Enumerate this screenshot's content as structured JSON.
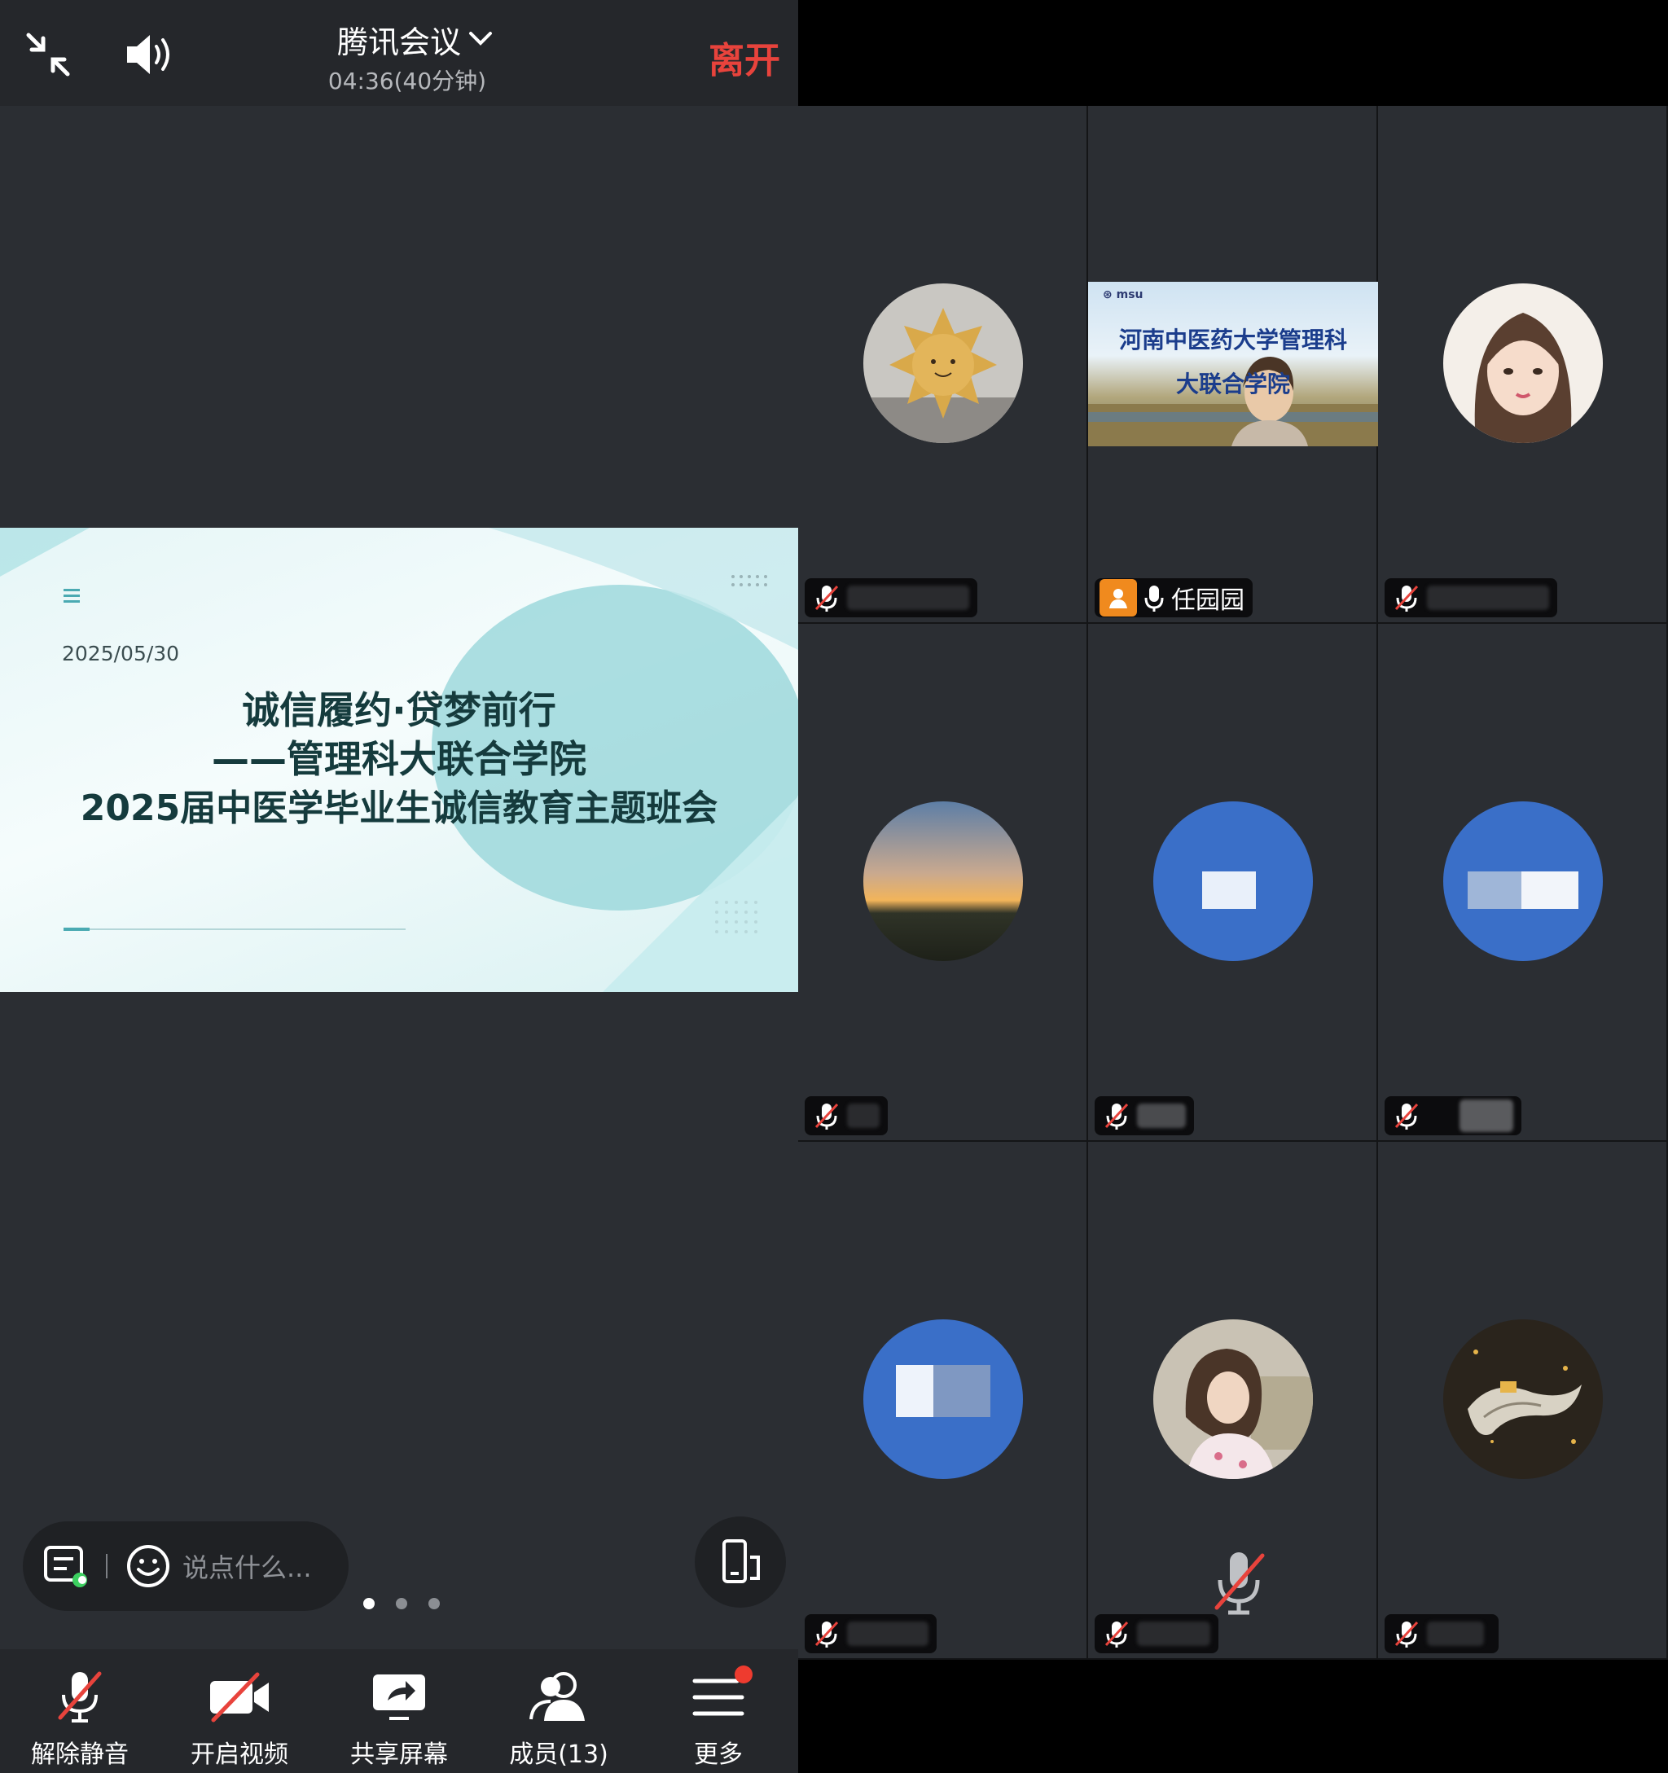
{
  "header": {
    "title": "腾讯会议",
    "elapsed": "04:36(40分钟)",
    "leave_label": "离开"
  },
  "slide": {
    "date": "2025/05/30",
    "line1": "诚信履约·贷梦前行",
    "line2": "——管理科大联合学院",
    "line3": "2025届中医学毕业生诚信教育主题班会"
  },
  "chat": {
    "placeholder": "说点什么..."
  },
  "pagination": {
    "count": 3,
    "active": 1
  },
  "toolbar": {
    "unmute_label": "解除静音",
    "video_label": "开启视频",
    "share_label": "共享屏幕",
    "members_label": "成员(13)",
    "more_label": "更多"
  },
  "participants": [
    {
      "name": "",
      "muted": true,
      "avatar": "sun-plush-avatar"
    },
    {
      "name": "任园园",
      "muted": false,
      "host": true,
      "video_text1": "河南中医药大学管理科",
      "video_text2": "大联合学院"
    },
    {
      "name": "",
      "muted": true,
      "avatar": "illustrated-girl-avatar"
    },
    {
      "name": "",
      "muted": true,
      "avatar": "sunset-avatar"
    },
    {
      "name": "",
      "muted": true,
      "avatar": "blue-initial-avatar"
    },
    {
      "name": "",
      "muted": true,
      "avatar": "blue-initial-avatar"
    },
    {
      "name": "",
      "muted": true,
      "avatar": "blue-initial-avatar"
    },
    {
      "name": "",
      "muted": true,
      "avatar": "portrait-photo-avatar"
    },
    {
      "name": "",
      "muted": true,
      "avatar": "dragon-avatar"
    }
  ],
  "colors": {
    "leave": "#e8433c",
    "host_badge": "#f08a1e",
    "avatar_blue": "#3a6fc8",
    "mute_red": "#e8433c"
  }
}
